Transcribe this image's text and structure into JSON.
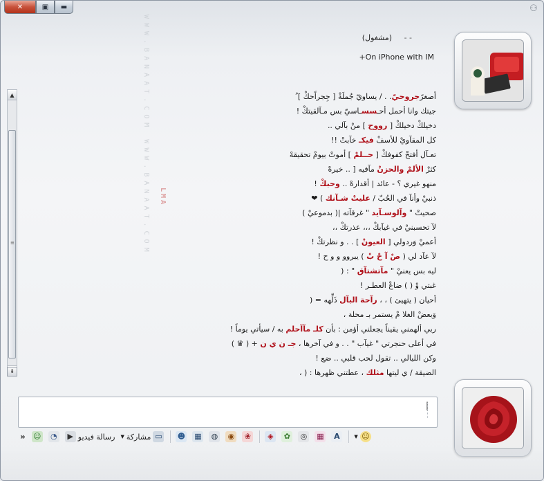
{
  "window": {
    "caption": {
      "close_glyph": "✕",
      "maximize_glyph": "▣",
      "minimize_glyph": "▬"
    },
    "top_right_icon": "people-icon"
  },
  "watermark": {
    "text": "WWW.BANAAT.COM WWW.BANAAT.COM",
    "red_text": "LMA"
  },
  "contact": {
    "name": "(مشغول)",
    "dash": "- -",
    "status": "+On iPhone with IM"
  },
  "messages": [
    {
      "pre": "أصغرً",
      "red": "جروحيّ",
      "post": ". . / يساويّ جُملَةْ [ جِجراًحكْ ] ُ"
    },
    {
      "pre": "جيتك وانا أحمل أحـ",
      "red": "سس",
      "post": "ـاسيّ بس مـآلقيتكْ  !"
    },
    {
      "pre": "دخيلكْ دخيلكْ [ ",
      "red": "رووح",
      "post": " ] منْ بآلي .."
    },
    {
      "pre": "كل المقآويْ للأسفْ ",
      "red": "فيكـ",
      "post": " خآبتْ !!"
    },
    {
      "pre": "تعـآل أفتحْ كفوفكْ [ ",
      "red": "حــلمْ",
      "post": " ] أموتْ بيومْ تحقيقهْ"
    },
    {
      "pre": "كثرْ ",
      "red": "الألمْ والحزنْ",
      "post": " مآفيه [ .. خيرهْ"
    },
    {
      "pre": "منهو غيري ؟ - عائد | أقدارهْ .. ",
      "red": "وحبكْ",
      "post": " !"
    },
    {
      "pre": "ذنبيْ وأنآ في الحُبّ / ",
      "red": "عليتْ  شـآنك",
      "post": " ) ❤"
    },
    {
      "pre": "صحيتْ \" ",
      "red": "وآلوسـآيد",
      "post": " \" غرقآته |( بدموعيْ )"
    },
    {
      "pre": "لآ تحسبنيْ في غيآبكْ ،،، عذرتكْ ،،",
      "red": "",
      "post": ""
    },
    {
      "pre": "أعميْ وَردولي [ ",
      "red": "العيونْ",
      "post": " ] . . و نظرتكْ !"
    },
    {
      "pre": "لآ عآد لي ( ",
      "red": "صْ آ حْ بْ",
      "post": " ) يبروو و و ح !"
    },
    {
      "pre": "ليه بس يعنيْ \" ",
      "red": "مآتشتآق",
      "post": " \" :  ("
    },
    {
      "pre": "غبتي وْ ( ) ضاعْ العطـر ",
      "red": "",
      "post": " !"
    },
    {
      "pre": "أحيان ( يتهيئ ) ، ، ",
      "red": "رآحة البآل",
      "post": " ذَلِّهه = ("
    },
    {
      "pre": "وَبعضْ الغلا مْ يستمر بـ محلة ،",
      "red": "",
      "post": ""
    },
    {
      "pre": "ربي ألهمني يقيناً يجعلني أؤمن : بأن ",
      "red": "كلـ مآآحلم",
      "post": " به / سيأتي يوماً !"
    },
    {
      "pre": "في أعلى حنجرتي \" غيآب \" . . و في آخرها ، ",
      "red": "جـ ن ي ن",
      "post": " + ( ♛ )"
    },
    {
      "pre": "وكن الليالي .. تقول لحب قلبي .. ",
      "red": "",
      "post": "ضع !"
    },
    {
      "pre": "الضيقة / ي ليتها ",
      "red": "مثلك",
      "post": " ، عطتني ظهرها : ( ،"
    }
  ],
  "input": {
    "value": "",
    "caret": "|"
  },
  "toolbar": {
    "more_label": "»",
    "video_call_label": "رسالة فيديو",
    "share_label": "مشاركة",
    "items": [
      {
        "name": "contact-status-icon",
        "glyph": "☺"
      },
      {
        "name": "nudge-icon",
        "glyph": "◔"
      },
      {
        "name": "video-message-icon",
        "glyph": "▶"
      },
      {
        "name": "share-icon",
        "glyph": "▭"
      },
      {
        "name": "buddy-icon",
        "glyph": "☻"
      },
      {
        "name": "contacts-icon",
        "glyph": "▦"
      },
      {
        "name": "ink-icon",
        "glyph": "◍"
      },
      {
        "name": "games-icon",
        "glyph": "◉"
      },
      {
        "name": "activities-icon",
        "glyph": "❀"
      },
      {
        "name": "photos-icon",
        "glyph": "▤"
      },
      {
        "name": "nudge-shake-icon",
        "glyph": "◈"
      },
      {
        "name": "wink-icon",
        "glyph": "✿"
      },
      {
        "name": "voice-clip-icon",
        "glyph": "◎"
      },
      {
        "name": "background-icon",
        "glyph": "▦"
      },
      {
        "name": "font-icon",
        "glyph": "A"
      },
      {
        "name": "emoticon-icon",
        "glyph": "☺"
      }
    ]
  },
  "colors": {
    "accent_red": "#b0111a",
    "frame": "#8d96a3"
  }
}
